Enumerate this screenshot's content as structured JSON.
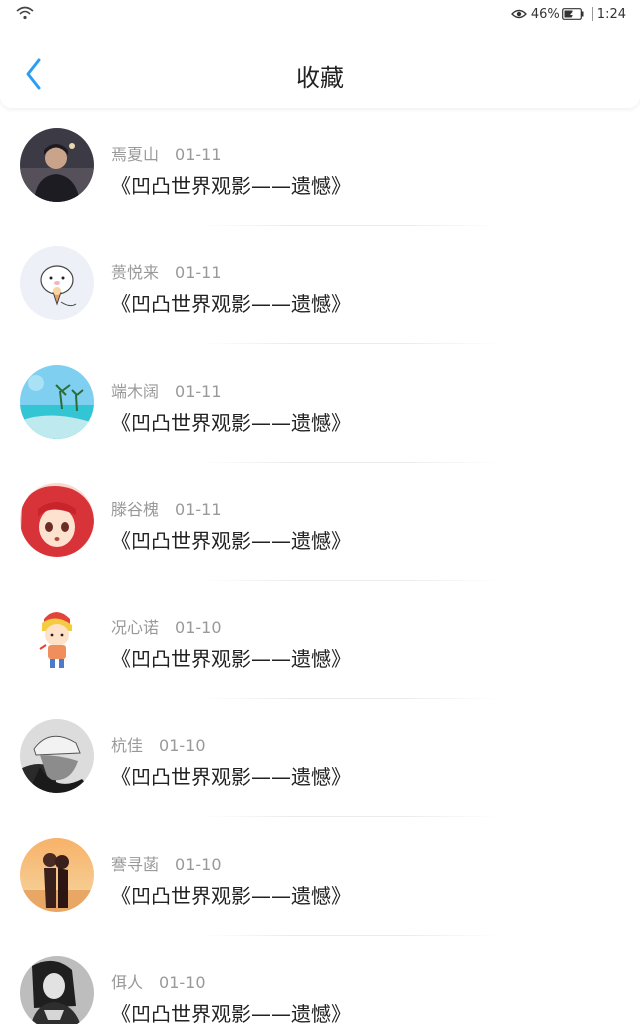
{
  "status_bar": {
    "battery": "46%",
    "time": "1:24",
    "icons": [
      "wifi-icon",
      "eye-icon",
      "battery-icon"
    ]
  },
  "header": {
    "title": "收藏",
    "back_icon": "chevron-left-icon",
    "accent": "#2a9df4"
  },
  "items": [
    {
      "name": "焉夏山",
      "date": "01-11",
      "title": "《凹凸世界观影——遗憾》",
      "avatar": "photo-man-night"
    },
    {
      "name": "蒉悦来",
      "date": "01-11",
      "title": "《凹凸世界观影——遗憾》",
      "avatar": "cartoon-pig"
    },
    {
      "name": "端木阔",
      "date": "01-11",
      "title": "《凹凸世界观影——遗憾》",
      "avatar": "beach-august"
    },
    {
      "name": "滕谷槐",
      "date": "01-11",
      "title": "《凹凸世界观影——遗憾》",
      "avatar": "anime-redhair-girl"
    },
    {
      "name": "况心诺",
      "date": "01-10",
      "title": "《凹凸世界观影——遗憾》",
      "avatar": "cartoon-boy"
    },
    {
      "name": "杭佳",
      "date": "01-10",
      "title": "《凹凸世界观影——遗憾》",
      "avatar": "bw-cap-person"
    },
    {
      "name": "謇寻菡",
      "date": "01-10",
      "title": "《凹凸世界观影——遗憾》",
      "avatar": "sunset-couple"
    },
    {
      "name": "佴人",
      "date": "01-10",
      "title": "《凹凸世界观影——遗憾》",
      "avatar": "bw-woman"
    }
  ]
}
